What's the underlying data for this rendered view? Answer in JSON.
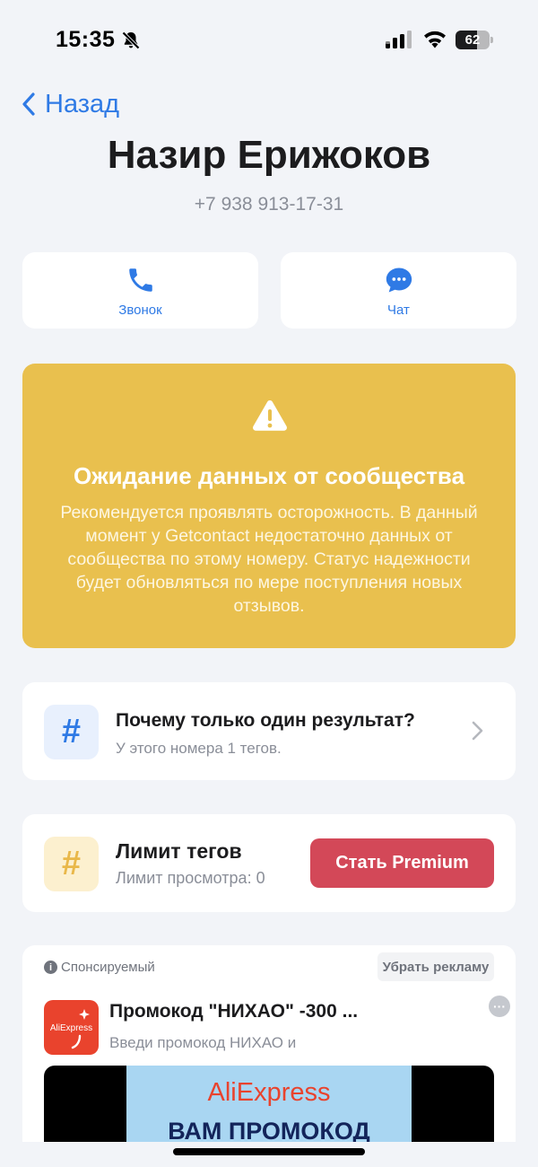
{
  "status_bar": {
    "time": "15:35",
    "battery_level": "62",
    "icons": [
      "bell-off-icon",
      "signal-icon",
      "wifi-icon",
      "battery-icon"
    ]
  },
  "nav": {
    "back_label": "Назад"
  },
  "contact": {
    "name": "Назир Ерижоков",
    "phone": "+7 938 913-17-31"
  },
  "actions": {
    "call_label": "Звонок",
    "chat_label": "Чат"
  },
  "warning": {
    "title": "Ожидание данных от сообщества",
    "text": "Рекомендуется проявлять осторожность. В данный момент у Getcontact недостаточно данных от сообщества по этому номеру. Статус надежности будет обновляться по мере поступления новых отзывов."
  },
  "tags": {
    "title": "Почему только один результат?",
    "subtitle": "У этого номера 1 тегов."
  },
  "limit": {
    "title": "Лимит тегов",
    "subtitle": "Лимит просмотра: 0",
    "premium_label": "Стать Premium"
  },
  "ad": {
    "sponsored_label": "Спонсируемый",
    "remove_label": "Убрать рекламу",
    "logo_text": "AliExpress",
    "title": "Промокод \"НИХАО\" -300 ...",
    "text": "Введи промокод НИХАО и",
    "banner_brand": "AliExpress",
    "banner_promo": "ВАМ ПРОМОКОД"
  },
  "colors": {
    "accent": "#2f7ae5",
    "warning": "#e9c04e",
    "premium": "#d34858",
    "background": "#f2f4f8"
  }
}
